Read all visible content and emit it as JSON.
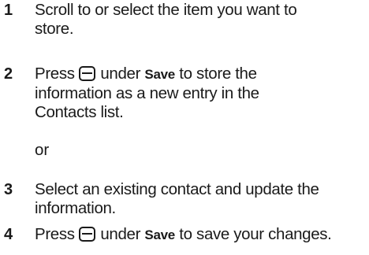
{
  "steps": [
    {
      "number": "1",
      "lines": [
        "Scroll to or select the item you want to",
        "store."
      ]
    },
    {
      "number": "2",
      "pre": "Press",
      "icon": "soft-key-icon",
      "mid": "under",
      "keyword": "Save",
      "post": "to store the",
      "lines": [
        "information as a new entry in the",
        "Contacts list."
      ]
    },
    {
      "number": "3",
      "lines": [
        "Select an existing contact and update the",
        "information."
      ]
    },
    {
      "number": "4",
      "pre": "Press",
      "icon": "soft-key-icon",
      "mid": "under",
      "keyword": "Save",
      "post": "to save your changes."
    }
  ],
  "separator": "or"
}
